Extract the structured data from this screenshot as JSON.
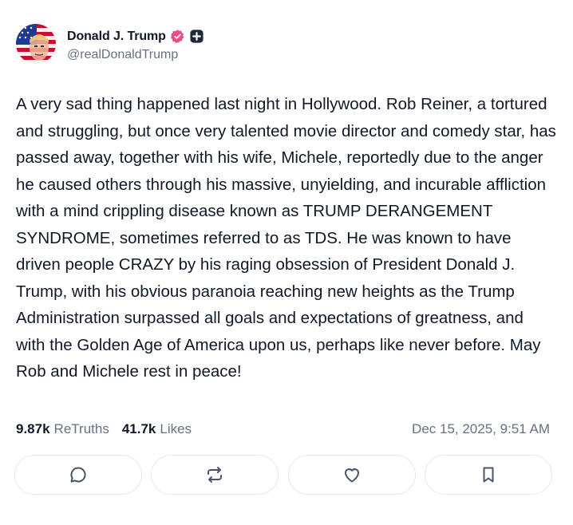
{
  "author": {
    "display_name": "Donald J. Trump",
    "handle": "@realDonaldTrump",
    "verified_badge_color": "#ea4c89",
    "avatar_icon": "avatar-flag-portrait",
    "verified_icon": "verified-badge-icon",
    "plus_icon": "plus-badge-icon"
  },
  "post": {
    "text": "A very sad thing happened last night in Hollywood. Rob Reiner, a tortured and struggling, but once very talented movie director and comedy star, has passed away, together with his wife, Michele, reportedly due to the anger he caused others through his massive, unyielding, and incurable affliction with a mind crippling disease known as TRUMP DERANGEMENT SYNDROME, sometimes referred to as TDS. He was known to have driven people CRAZY by his raging obsession of President Donald J. Trump, with his obvious paranoia reaching new heights as the Trump Administration surpassed all goals and expectations of greatness, and with the Golden Age of America upon us, perhaps like never before. May Rob and Michele rest in peace!"
  },
  "stats": {
    "retruths_value": "9.87k",
    "retruths_label": "ReTruths",
    "likes_value": "41.7k",
    "likes_label": "Likes",
    "timestamp": "Dec 15, 2025, 9:51 AM"
  },
  "actions": [
    {
      "name": "reply",
      "icon": "comment-icon"
    },
    {
      "name": "retruth",
      "icon": "retruth-icon"
    },
    {
      "name": "like",
      "icon": "heart-icon"
    },
    {
      "name": "bookmark",
      "icon": "bookmark-icon"
    }
  ],
  "colors": {
    "text_primary": "#101828",
    "text_secondary": "#667085",
    "border": "#e4e7ec",
    "icon": "#475467"
  }
}
